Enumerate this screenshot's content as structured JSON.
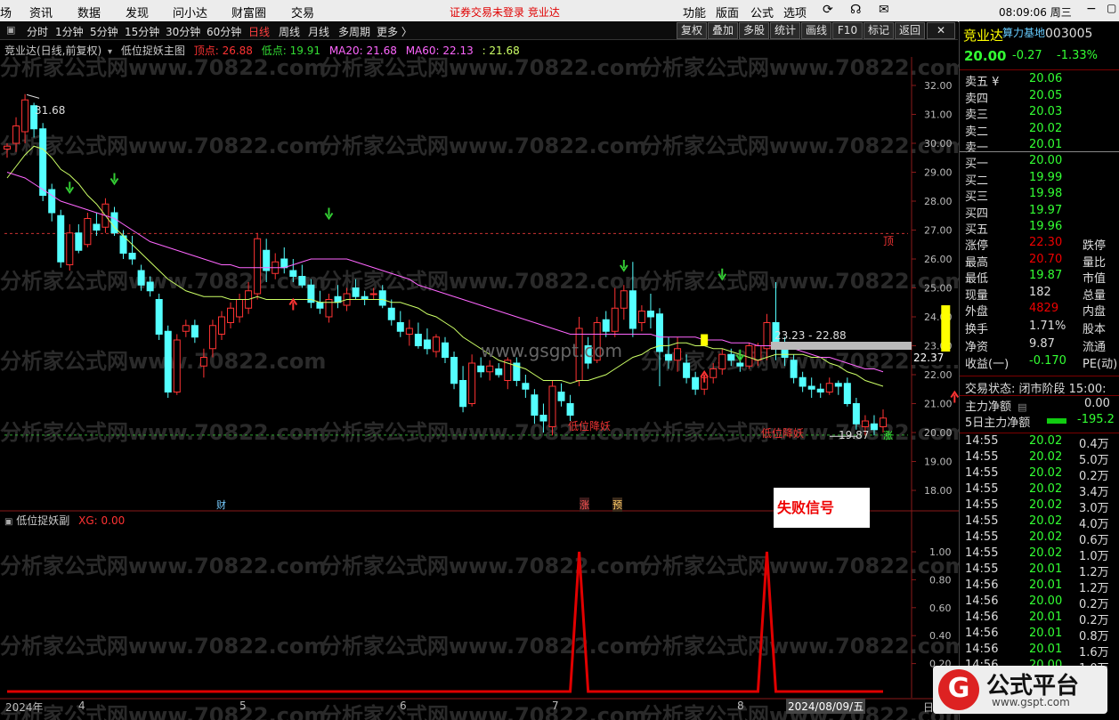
{
  "menu": {
    "items": [
      "场",
      "资讯",
      "数据",
      "发现",
      "问小达",
      "财富圈",
      "交易"
    ],
    "notice": "证券交易未登录  竞业达",
    "right_items": [
      "功能",
      "版面",
      "公式",
      "选项"
    ],
    "time": "08:09:06 周三"
  },
  "toolbar": {
    "periods": [
      "分时",
      "1分钟",
      "5分钟",
      "15分钟",
      "30分钟",
      "60分钟",
      "日线",
      "周线",
      "月线",
      "多周期",
      "更多 〉"
    ],
    "buttons": [
      "复权",
      "叠加",
      "多股",
      "统计",
      "画线",
      "F10",
      "标记",
      "返回"
    ]
  },
  "main_legend": {
    "title": "竞业达(日线,前复权)",
    "formula": "低位捉妖主图",
    "top_label": "顶点: 26.88",
    "low_label": "低点: 19.91",
    "ma20": "MA20: 21.68",
    "ma60": "MA60: 22.13",
    "extra": ": 21.68"
  },
  "sub_legend": {
    "formula": "低位捉妖副",
    "xg": "XG: 0.00"
  },
  "watermark": "分析家公式网www.70822.com",
  "center_watermark": "www.gsgpt.com",
  "annotations": {
    "high_price": "31.68",
    "low_price": "19.87",
    "range": "23.23 - 22.88",
    "current_price": "22.37",
    "top_tag": "顶",
    "low_signal_1": "低位降妖",
    "low_signal_2": "低位降妖",
    "fail_signal": "失败信号",
    "cai": "财",
    "zhang": "涨",
    "yu": "预",
    "zhang2": "涨"
  },
  "xaxis": {
    "labels": [
      "2024年",
      "4",
      "5",
      "6",
      "7",
      "8",
      "2024/08/09/五",
      "日"
    ]
  },
  "chart_data": [
    {
      "type": "candlestick",
      "title": "竞业达(日线,前复权)",
      "ylim": [
        17.6,
        32.8
      ],
      "yticks": [
        18.0,
        19.0,
        20.0,
        21.0,
        22.0,
        23.0,
        24.0,
        25.0,
        26.0,
        27.0,
        28.0,
        29.0,
        30.0,
        31.0,
        32.0
      ],
      "top_line": 26.88,
      "low_line": 19.91,
      "high_mark": 31.68,
      "low_mark": 19.87,
      "last_price": 22.37,
      "candles": [
        [
          29.8,
          30.0,
          29.5,
          29.9
        ],
        [
          30.0,
          30.9,
          29.7,
          30.6
        ],
        [
          30.4,
          31.7,
          30.0,
          31.5
        ],
        [
          31.3,
          31.4,
          30.2,
          30.5
        ],
        [
          30.5,
          30.7,
          28.0,
          28.2
        ],
        [
          28.4,
          28.6,
          27.3,
          27.6
        ],
        [
          27.5,
          27.7,
          25.7,
          25.9
        ],
        [
          25.8,
          27.2,
          25.6,
          26.9
        ],
        [
          26.9,
          27.2,
          26.2,
          26.3
        ],
        [
          26.5,
          27.6,
          26.4,
          27.4
        ],
        [
          27.2,
          27.6,
          26.8,
          27.0
        ],
        [
          27.1,
          28.1,
          26.9,
          27.9
        ],
        [
          27.6,
          27.8,
          26.8,
          26.9
        ],
        [
          26.8,
          27.0,
          26.0,
          26.2
        ],
        [
          26.2,
          26.8,
          25.8,
          26.0
        ],
        [
          25.6,
          25.8,
          24.9,
          25.1
        ],
        [
          25.2,
          25.4,
          24.7,
          24.9
        ],
        [
          24.6,
          24.8,
          23.2,
          23.4
        ],
        [
          23.5,
          23.7,
          21.2,
          21.4
        ],
        [
          21.4,
          23.4,
          21.3,
          23.2
        ],
        [
          23.5,
          23.9,
          23.3,
          23.7
        ],
        [
          23.7,
          23.9,
          23.1,
          23.3
        ],
        [
          22.3,
          22.9,
          21.9,
          22.6
        ],
        [
          22.9,
          23.9,
          22.6,
          23.7
        ],
        [
          23.4,
          24.2,
          23.2,
          24.0
        ],
        [
          23.8,
          24.5,
          23.6,
          24.3
        ],
        [
          24.0,
          24.8,
          23.8,
          24.6
        ],
        [
          24.3,
          25.2,
          24.1,
          24.9
        ],
        [
          24.8,
          26.9,
          24.6,
          26.7
        ],
        [
          26.3,
          26.7,
          25.2,
          25.6
        ],
        [
          25.5,
          26.2,
          25.3,
          25.9
        ],
        [
          26.0,
          26.4,
          25.5,
          25.7
        ],
        [
          25.6,
          26.0,
          25.2,
          25.4
        ],
        [
          25.4,
          25.8,
          25.0,
          25.1
        ],
        [
          25.1,
          25.3,
          24.3,
          24.5
        ],
        [
          24.5,
          24.9,
          24.1,
          24.3
        ],
        [
          24.0,
          24.8,
          23.8,
          24.6
        ],
        [
          24.7,
          25.1,
          24.3,
          24.5
        ],
        [
          24.4,
          25.0,
          24.2,
          24.8
        ],
        [
          25.0,
          25.3,
          24.6,
          24.7
        ],
        [
          24.7,
          24.9,
          24.4,
          24.6
        ],
        [
          24.8,
          25.0,
          24.6,
          24.8
        ],
        [
          24.9,
          25.1,
          24.3,
          24.4
        ],
        [
          24.3,
          24.6,
          23.7,
          23.9
        ],
        [
          23.8,
          24.2,
          23.3,
          23.5
        ],
        [
          23.4,
          23.9,
          23.0,
          23.6
        ],
        [
          23.4,
          23.8,
          22.9,
          23.0
        ],
        [
          23.2,
          23.6,
          22.7,
          22.9
        ],
        [
          22.8,
          23.4,
          22.6,
          23.3
        ],
        [
          23.1,
          23.3,
          22.4,
          22.6
        ],
        [
          22.6,
          22.8,
          21.5,
          21.7
        ],
        [
          21.8,
          22.3,
          20.7,
          20.9
        ],
        [
          21.0,
          22.7,
          20.9,
          22.4
        ],
        [
          22.3,
          22.6,
          21.9,
          22.1
        ],
        [
          22.1,
          22.5,
          21.8,
          22.3
        ],
        [
          22.2,
          22.4,
          21.9,
          22.0
        ],
        [
          21.8,
          22.6,
          21.5,
          22.5
        ],
        [
          22.4,
          22.6,
          21.6,
          21.8
        ],
        [
          21.7,
          22.0,
          21.2,
          21.5
        ],
        [
          21.3,
          21.5,
          20.3,
          20.6
        ],
        [
          20.6,
          21.0,
          20.0,
          20.4
        ],
        [
          20.2,
          21.8,
          19.9,
          21.6
        ],
        [
          21.4,
          21.7,
          20.9,
          21.1
        ],
        [
          21.0,
          21.3,
          20.4,
          20.6
        ],
        [
          21.8,
          24.0,
          21.6,
          23.6
        ],
        [
          23.0,
          23.3,
          22.2,
          22.4
        ],
        [
          22.5,
          24.0,
          22.4,
          23.8
        ],
        [
          23.9,
          24.2,
          23.3,
          23.5
        ],
        [
          23.5,
          25.0,
          23.3,
          24.3
        ],
        [
          24.3,
          25.1,
          23.9,
          24.9
        ],
        [
          24.9,
          25.9,
          23.3,
          23.6
        ],
        [
          23.8,
          24.4,
          23.5,
          24.2
        ],
        [
          24.2,
          24.8,
          23.6,
          24.0
        ],
        [
          24.1,
          24.3,
          21.6,
          22.8
        ],
        [
          22.7,
          23.3,
          22.2,
          22.5
        ],
        [
          22.5,
          23.3,
          22.1,
          22.9
        ],
        [
          22.4,
          22.7,
          21.7,
          21.9
        ],
        [
          21.9,
          22.1,
          21.3,
          21.5
        ],
        [
          21.5,
          22.0,
          21.3,
          21.9
        ],
        [
          21.9,
          22.4,
          21.7,
          22.2
        ],
        [
          22.2,
          22.9,
          22.0,
          22.7
        ],
        [
          22.7,
          22.9,
          22.3,
          22.5
        ],
        [
          22.4,
          22.7,
          22.1,
          22.3
        ],
        [
          22.3,
          23.1,
          22.2,
          23.0
        ],
        [
          22.5,
          23.1,
          22.3,
          23.0
        ],
        [
          22.9,
          24.1,
          22.5,
          23.8
        ],
        [
          23.8,
          25.2,
          22.5,
          22.9
        ],
        [
          22.9,
          23.3,
          22.3,
          22.6
        ],
        [
          22.5,
          22.7,
          21.7,
          21.9
        ],
        [
          21.9,
          22.1,
          21.4,
          21.6
        ],
        [
          21.6,
          21.9,
          21.2,
          21.5
        ],
        [
          21.5,
          21.7,
          21.2,
          21.4
        ],
        [
          21.4,
          21.9,
          21.3,
          21.7
        ],
        [
          21.7,
          21.8,
          21.3,
          21.6
        ],
        [
          21.7,
          21.9,
          20.9,
          21.0
        ],
        [
          21.0,
          21.2,
          20.1,
          20.3
        ],
        [
          20.2,
          20.6,
          19.9,
          20.4
        ],
        [
          20.3,
          20.6,
          19.9,
          20.1
        ],
        [
          20.2,
          20.8,
          20.0,
          20.5
        ]
      ],
      "series": [
        {
          "name": "MA20",
          "values": [
            28.8,
            29.2,
            29.6,
            29.9,
            29.8,
            29.5,
            29.1,
            28.9,
            28.6,
            28.2,
            27.9,
            27.5,
            27.1,
            26.8,
            26.5,
            26.2,
            25.9,
            25.6,
            25.3,
            25.1,
            24.9,
            24.8,
            24.7,
            24.7,
            24.7,
            24.6,
            24.6,
            24.6,
            24.7,
            24.6,
            24.6,
            24.6,
            24.6,
            24.6,
            24.6,
            24.5,
            24.5,
            24.5,
            24.6,
            24.6,
            24.6,
            24.6,
            24.6,
            24.5,
            24.5,
            24.4,
            24.3,
            24.1,
            24.0,
            23.8,
            23.6,
            23.3,
            23.1,
            22.9,
            22.7,
            22.5,
            22.4,
            22.3,
            22.2,
            22.0,
            21.8,
            21.8,
            21.8,
            21.7,
            21.8,
            21.8,
            21.9,
            22.0,
            22.2,
            22.4,
            22.6,
            22.7,
            22.9,
            23.0,
            23.0,
            23.1,
            23.1,
            23.0,
            23.0,
            22.9,
            22.9,
            22.8,
            22.7,
            22.6,
            22.5,
            22.6,
            22.7,
            22.7,
            22.7,
            22.7,
            22.6,
            22.6,
            22.4,
            22.3,
            22.1,
            22.0,
            21.8,
            21.7,
            21.6
          ]
        },
        {
          "name": "MA60",
          "values": [
            29.0,
            28.9,
            28.8,
            28.6,
            28.4,
            28.2,
            28.0,
            27.9,
            27.8,
            27.7,
            27.6,
            27.5,
            27.4,
            27.2,
            27.0,
            26.8,
            26.6,
            26.5,
            26.4,
            26.3,
            26.2,
            26.1,
            26.0,
            25.9,
            25.8,
            25.8,
            25.7,
            25.7,
            25.7,
            25.7,
            25.7,
            25.7,
            25.8,
            25.9,
            26.0,
            26.0,
            26.0,
            26.0,
            26.0,
            25.9,
            25.8,
            25.7,
            25.6,
            25.5,
            25.4,
            25.3,
            25.1,
            25.0,
            24.9,
            24.8,
            24.7,
            24.6,
            24.5,
            24.4,
            24.3,
            24.2,
            24.1,
            24.0,
            23.9,
            23.8,
            23.7,
            23.6,
            23.5,
            23.4,
            23.4,
            23.4,
            23.4,
            23.4,
            23.4,
            23.4,
            23.4,
            23.4,
            23.4,
            23.3,
            23.3,
            23.3,
            23.3,
            23.3,
            23.2,
            23.2,
            23.2,
            23.1,
            23.1,
            23.1,
            23.0,
            23.0,
            23.0,
            22.9,
            22.9,
            22.8,
            22.7,
            22.6,
            22.6,
            22.5,
            22.4,
            22.3,
            22.2,
            22.2,
            22.1
          ]
        }
      ]
    },
    {
      "type": "line",
      "title": "低位捉妖副",
      "ylim": [
        0.0,
        1.0
      ],
      "yticks": [
        0.2,
        0.4,
        0.6,
        0.8,
        1.0
      ],
      "series": [
        {
          "name": "XG",
          "values": [
            0,
            0,
            0,
            0,
            0,
            0,
            0,
            0,
            0,
            0,
            0,
            0,
            0,
            0,
            0,
            0,
            0,
            0,
            0,
            0,
            0,
            0,
            0,
            0,
            0,
            0,
            0,
            0,
            0,
            0,
            0,
            0,
            0,
            0,
            0,
            0,
            0,
            0,
            0,
            0,
            0,
            0,
            0,
            0,
            0,
            0,
            0,
            0,
            0,
            0,
            0,
            0,
            0,
            0,
            0,
            0,
            0,
            0,
            0,
            0,
            0,
            0,
            0,
            0,
            1,
            0,
            0,
            0,
            0,
            0,
            0,
            0,
            0,
            0,
            0,
            0,
            0,
            0,
            0,
            0,
            0,
            0,
            0,
            0,
            0,
            1,
            0,
            0,
            0,
            0,
            0,
            0,
            0,
            0,
            0,
            0,
            0,
            0,
            0
          ]
        }
      ]
    }
  ],
  "quote": {
    "name": "竞业达",
    "tag": "算力基地",
    "code": "003005",
    "price": "20.00",
    "change": "-0.27",
    "pct": "-1.33%",
    "sells": [
      [
        "卖五 ¥",
        "20.06"
      ],
      [
        "卖四",
        "20.05"
      ],
      [
        "卖三",
        "20.03"
      ],
      [
        "卖二",
        "20.02"
      ],
      [
        "卖一",
        "20.01"
      ]
    ],
    "buys": [
      [
        "买一",
        "20.00"
      ],
      [
        "买二",
        "19.99"
      ],
      [
        "买三",
        "19.98"
      ],
      [
        "买四",
        "19.97"
      ],
      [
        "买五",
        "19.96"
      ]
    ],
    "stats": [
      [
        "涨停",
        "22.30",
        "跌停"
      ],
      [
        "最高",
        "20.70",
        "量比"
      ],
      [
        "最低",
        "19.87",
        "市值"
      ],
      [
        "现量",
        "182",
        "总量"
      ],
      [
        "外盘",
        "4829",
        "内盘"
      ],
      [
        "换手",
        "1.71%",
        "股本"
      ],
      [
        "净资",
        "9.87",
        "流通"
      ],
      [
        "收益(一)",
        "-0.170",
        "PE(动)"
      ]
    ],
    "trade_status": "交易状态: 闭市阶段 15:00:",
    "main_net": [
      "主力净额",
      "0.00"
    ],
    "main_net5": [
      "5日主力净额",
      "-195.2"
    ],
    "ticks": [
      [
        "14:55",
        "20.02",
        "0.4万"
      ],
      [
        "14:55",
        "20.02",
        "5.0万"
      ],
      [
        "14:55",
        "20.02",
        "0.2万"
      ],
      [
        "14:55",
        "20.02",
        "3.4万"
      ],
      [
        "14:55",
        "20.02",
        "3.0万"
      ],
      [
        "14:55",
        "20.02",
        "4.0万"
      ],
      [
        "14:55",
        "20.02",
        "0.6万"
      ],
      [
        "14:55",
        "20.02",
        "1.0万"
      ],
      [
        "14:55",
        "20.01",
        "1.2万"
      ],
      [
        "14:56",
        "20.01",
        "1.2万"
      ],
      [
        "14:56",
        "20.00",
        "0.2万"
      ],
      [
        "14:56",
        "20.01",
        "0.2万"
      ],
      [
        "14:56",
        "20.01",
        "0.8万"
      ],
      [
        "14:56",
        "20.01",
        "1.6万"
      ],
      [
        "14:56",
        "20.00",
        "1.0万"
      ]
    ]
  },
  "brand": {
    "name": "公式平台",
    "url": "www.gspt.com"
  },
  "colors": {
    "up": "#ff3333",
    "down": "#54ffff",
    "ma20": "#ccff66",
    "ma60": "#ff66ff",
    "topline": "#c33",
    "signal": "#e00000"
  }
}
